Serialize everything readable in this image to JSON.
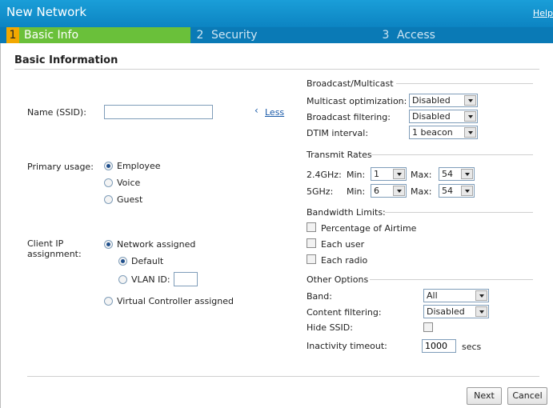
{
  "header": {
    "title": "New Network",
    "help_link": "Help"
  },
  "steps": [
    {
      "num": "1",
      "label": "Basic Info"
    },
    {
      "num": "2",
      "label": "Security"
    },
    {
      "num": "3",
      "label": "Access"
    }
  ],
  "section_title": "Basic Information",
  "left": {
    "name_label": "Name (SSID):",
    "name_value": "",
    "less_link": "Less",
    "primary_usage_label": "Primary usage:",
    "usage_options": [
      "Employee",
      "Voice",
      "Guest"
    ],
    "usage_selected": "Employee",
    "client_ip_label_1": "Client IP",
    "client_ip_label_2": "assignment:",
    "network_assigned": "Network assigned",
    "default_option": "Default",
    "vlan_id_label": "VLAN ID:",
    "vlan_id_value": "",
    "virtual_controller": "Virtual Controller assigned"
  },
  "broadcast": {
    "title": "Broadcast/Multicast",
    "multicast_label": "Multicast optimization:",
    "multicast_value": "Disabled",
    "broadcast_label": "Broadcast filtering:",
    "broadcast_value": "Disabled",
    "dtim_label": "DTIM interval:",
    "dtim_value": "1 beacon"
  },
  "rates": {
    "title": "Transmit Rates",
    "g24_label": "2.4GHz:",
    "g5_label": "5GHz:",
    "min_label": "Min:",
    "max_label": "Max:",
    "g24_min": "1",
    "g24_max": "54",
    "g5_min": "6",
    "g5_max": "54"
  },
  "bandwidth": {
    "title": "Bandwidth Limits:",
    "airtime": "Percentage of Airtime",
    "each_user": "Each user",
    "each_radio": "Each radio"
  },
  "other": {
    "title": "Other Options",
    "band_label": "Band:",
    "band_value": "All",
    "content_label": "Content filtering:",
    "content_value": "Disabled",
    "hide_ssid_label": "Hide SSID:",
    "inactivity_label": "Inactivity timeout:",
    "inactivity_value": "1000",
    "inactivity_unit": "secs"
  },
  "footer": {
    "next_label": "Next",
    "cancel_label": "Cancel"
  }
}
